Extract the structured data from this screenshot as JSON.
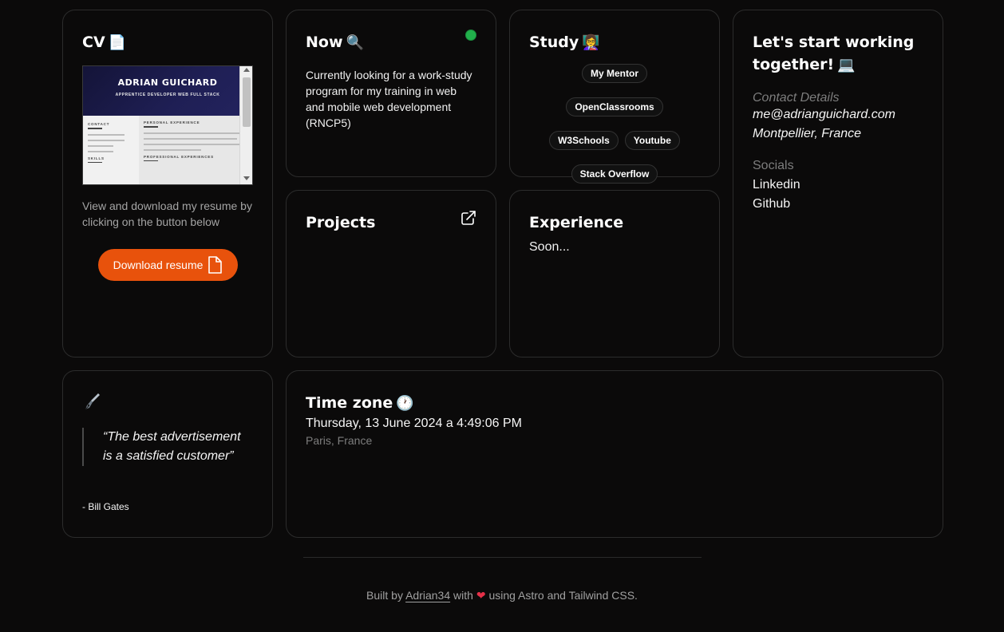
{
  "cv": {
    "title": "CV",
    "title_emoji": "📄",
    "preview": {
      "name": "ADRIAN GUICHARD",
      "role": "APPRENTICE DEVELOPER WEB FULL STACK",
      "contact_label": "CONTACT",
      "skills_label": "SKILLS",
      "personal_label": "PERSONAL EXPERIENCE",
      "professional_label": "PROFESSIONAL EXPERIENCES"
    },
    "description": "View and download my resume by clicking on the button below",
    "download_label": "Download resume"
  },
  "now": {
    "title": "Now",
    "title_emoji": "🔍",
    "status_color": "#21b04b",
    "text": "Currently looking for a work-study program for my training in web and mobile web development (RNCP5)"
  },
  "study": {
    "title": "Study",
    "title_emoji": "👩‍🏫",
    "tags": [
      "My Mentor",
      "OpenClassrooms",
      "W3Schools",
      "Youtube",
      "Stack Overflow"
    ]
  },
  "contact": {
    "title": "Let's start working together!",
    "title_emoji": "💻",
    "details_label": "Contact Details",
    "email": "me@adrianguichard.com",
    "location": "Montpellier, France",
    "socials_label": "Socials",
    "socials": [
      "Linkedin",
      "Github"
    ]
  },
  "projects": {
    "title": "Projects"
  },
  "experience": {
    "title": "Experience",
    "text": "Soon..."
  },
  "quote": {
    "text": "“The best advertisement is a satisfied customer”",
    "author": "- Bill Gates"
  },
  "timezone": {
    "title": "Time zone",
    "title_emoji": "🕐",
    "datetime": "Thursday, 13 June 2024 a 4:49:06 PM",
    "place": "Paris, France"
  },
  "footer": {
    "built_by": "Built by",
    "author": "Adrian34",
    "with": "with",
    "heart": "❤",
    "using": "using Astro and Tailwind CSS."
  },
  "colors": {
    "accent": "#e8520c",
    "background": "#0b0a0a",
    "border": "#2c2c2c",
    "muted": "#7d7d7d"
  }
}
